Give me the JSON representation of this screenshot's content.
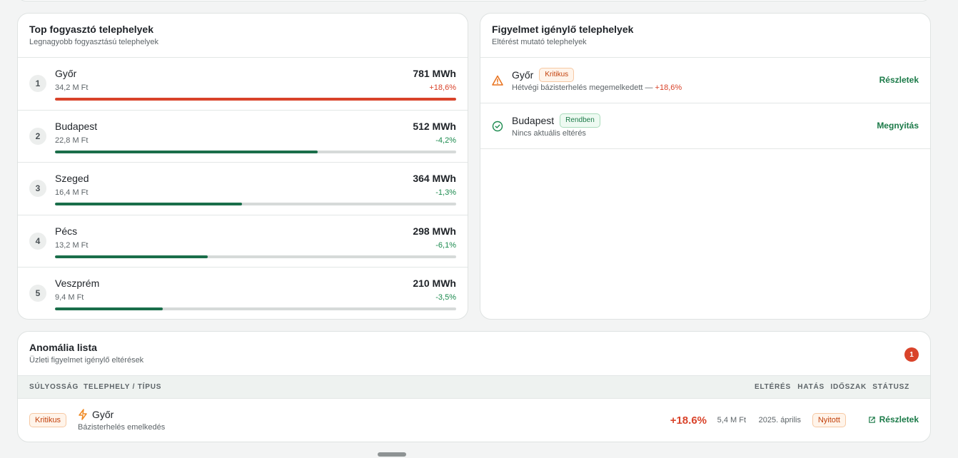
{
  "colors": {
    "up": "#d9432a",
    "down": "#1b8a4e",
    "bar_green": "#1a6e4a",
    "bar_red": "#d9432a",
    "accent_green": "#1b7a48",
    "critical": "#c2410c"
  },
  "top_consumers": {
    "title": "Top fogyasztó telephelyek",
    "subtitle": "Legnagyobb fogyasztású telephelyek",
    "rows": [
      {
        "rank": "1",
        "name": "Győr",
        "cost": "34,2 M Ft",
        "mwh": "781 MWh",
        "delta": "+18,6%",
        "trend": "up",
        "share": 1.0
      },
      {
        "rank": "2",
        "name": "Budapest",
        "cost": "22,8 M Ft",
        "mwh": "512 MWh",
        "delta": "-4,2%",
        "trend": "down",
        "share": 0.655
      },
      {
        "rank": "3",
        "name": "Szeged",
        "cost": "16,4 M Ft",
        "mwh": "364 MWh",
        "delta": "-1,3%",
        "trend": "down",
        "share": 0.466
      },
      {
        "rank": "4",
        "name": "Pécs",
        "cost": "13,2 M Ft",
        "mwh": "298 MWh",
        "delta": "-6,1%",
        "trend": "down",
        "share": 0.381
      },
      {
        "rank": "5",
        "name": "Veszprém",
        "cost": "9,4 M Ft",
        "mwh": "210 MWh",
        "delta": "-3,5%",
        "trend": "down",
        "share": 0.269
      }
    ]
  },
  "attention": {
    "title": "Figyelmet igénylő telephelyek",
    "subtitle": "Eltérést mutató telephelyek",
    "rows": [
      {
        "name": "Győr",
        "badge": "Kritikus",
        "status": "critical",
        "icon": "warning-icon",
        "desc": "Hétvégi bázisterhelés megemelkedett —",
        "desc_value": "+18,6%",
        "action": "Részletek"
      },
      {
        "name": "Budapest",
        "badge": "Rendben",
        "status": "ok",
        "icon": "check-circle-icon",
        "desc": "Nincs aktuális eltérés",
        "desc_value": "",
        "action": "Megnyitás"
      }
    ]
  },
  "anomalies": {
    "title": "Anomália lista",
    "subtitle": "Üzleti figyelmet igénylő eltérések",
    "count": "1",
    "headers": {
      "severity": "SÚLYOSSÁG",
      "site_type": "TELEPHELY / TÍPUS",
      "deviation": "ELTÉRÉS",
      "impact": "HATÁS",
      "period": "IDŐSZAK",
      "status": "STÁTUSZ"
    },
    "rows": [
      {
        "severity": "Kritikus",
        "site": "Győr",
        "type": "Bázisterhelés emelkedés",
        "icon": "bolt-icon",
        "deviation": "+18.6%",
        "impact": "5,4 M Ft",
        "period": "2025. április",
        "status": "Nyitott",
        "action": "Részletek"
      }
    ]
  }
}
